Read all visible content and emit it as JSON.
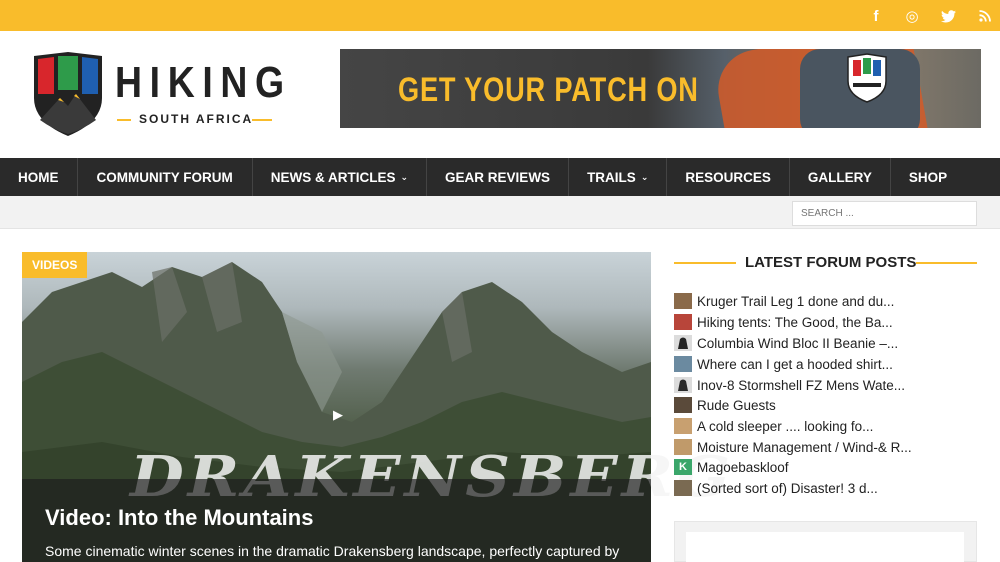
{
  "social": {
    "icons": [
      "facebook-icon",
      "instagram-icon",
      "twitter-icon",
      "rss-icon"
    ],
    "glyphs": [
      "f",
      "◎",
      "🐦",
      "≋"
    ]
  },
  "logo": {
    "title": "HIKING",
    "subtitle": "SOUTH AFRICA"
  },
  "banner": {
    "text": "GET YOUR PATCH ON"
  },
  "nav": {
    "items": [
      {
        "label": "HOME",
        "dropdown": false
      },
      {
        "label": "COMMUNITY FORUM",
        "dropdown": false
      },
      {
        "label": "NEWS & ARTICLES",
        "dropdown": true
      },
      {
        "label": "GEAR REVIEWS",
        "dropdown": false
      },
      {
        "label": "TRAILS",
        "dropdown": true
      },
      {
        "label": "RESOURCES",
        "dropdown": false
      },
      {
        "label": "GALLERY",
        "dropdown": false
      },
      {
        "label": "SHOP",
        "dropdown": false
      }
    ]
  },
  "search": {
    "placeholder": "SEARCH ..."
  },
  "feature": {
    "tag": "VIDEOS",
    "overlay_text": "DRAKENSBERG",
    "title": "Video: Into the Mountains",
    "excerpt": "Some cinematic winter scenes in the dramatic Drakensberg landscape, perfectly captured by"
  },
  "forum": {
    "heading": "LATEST FORUM POSTS",
    "posts": [
      {
        "title": "Kruger Trail Leg 1 done and du...",
        "thumb_color": "#8a6a4a"
      },
      {
        "title": "Hiking tents: The Good, the Ba...",
        "thumb_color": "#b8453a"
      },
      {
        "title": "Columbia Wind Bloc II Beanie –...",
        "thumb_color": "#222222"
      },
      {
        "title": "Where can I get a hooded shirt...",
        "thumb_color": "#6b8aa0"
      },
      {
        "title": "Inov-8 Stormshell FZ Mens Wate...",
        "thumb_color": "#2a2a2a"
      },
      {
        "title": "Rude Guests",
        "thumb_color": "#5a4a3a"
      },
      {
        "title": "A cold sleeper .... looking fo...",
        "thumb_color": "#c8a070"
      },
      {
        "title": "Moisture Management / Wind-& R...",
        "thumb_color": "#c09a6a"
      },
      {
        "title": "Magoebaskloof",
        "thumb_color": "#3aa66a",
        "letter": "K"
      },
      {
        "title": "(Sorted sort of) Disaster! 3 d...",
        "thumb_color": "#7a6a52"
      }
    ]
  }
}
